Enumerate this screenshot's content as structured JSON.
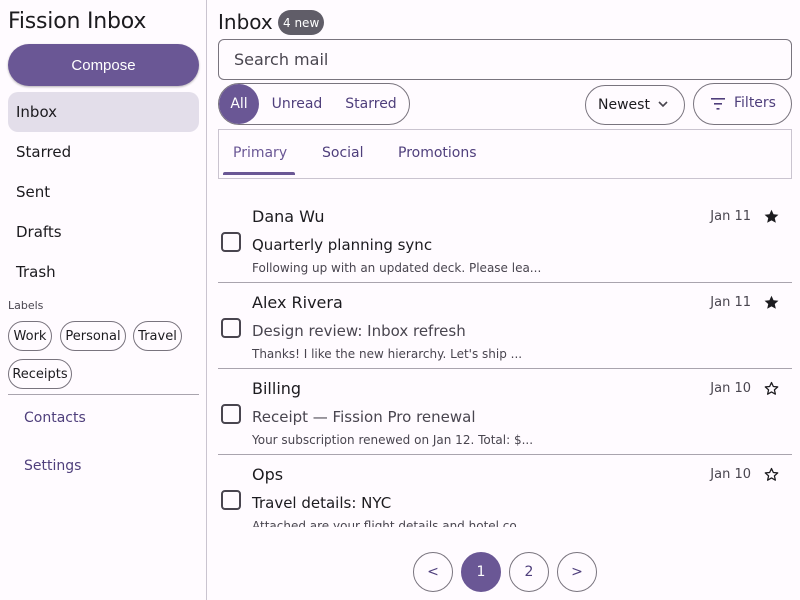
{
  "app_title": "Fission Inbox",
  "compose_label": "Compose",
  "nav": [
    {
      "label": "Inbox",
      "active": true
    },
    {
      "label": "Starred"
    },
    {
      "label": "Sent"
    },
    {
      "label": "Drafts"
    },
    {
      "label": "Trash"
    }
  ],
  "labels_title": "Labels",
  "labels": [
    "Work",
    "Personal",
    "Travel",
    "Receipts"
  ],
  "side_links": [
    "Contacts",
    "Settings"
  ],
  "header": {
    "title": "Inbox",
    "badge": "4 new"
  },
  "search": {
    "placeholder": "Search mail",
    "value": ""
  },
  "segments": [
    {
      "label": "All",
      "active": true
    },
    {
      "label": "Unread"
    },
    {
      "label": "Starred"
    }
  ],
  "sort": {
    "selected": "Newest",
    "icon": "chevron-down-icon"
  },
  "filters_label": "Filters",
  "tabs": [
    {
      "label": "Primary",
      "active": true
    },
    {
      "label": "Social"
    },
    {
      "label": "Promotions"
    }
  ],
  "messages": [
    {
      "sender": "Dana Wu",
      "subject": "Quarterly planning sync",
      "snippet": "Following up with an updated deck. Please lea...",
      "date": "Jan 11",
      "starred": true,
      "unread": true
    },
    {
      "sender": "Alex Rivera",
      "subject": "Design review: Inbox refresh",
      "snippet": "Thanks! I like the new hierarchy. Let's ship ...",
      "date": "Jan 11",
      "starred": true,
      "unread": false
    },
    {
      "sender": "Billing",
      "subject": "Receipt — Fission Pro renewal",
      "snippet": "Your subscription renewed on Jan 12. Total: $...",
      "date": "Jan 10",
      "starred": false,
      "unread": false
    },
    {
      "sender": "Ops",
      "subject": "Travel details: NYC",
      "snippet": "Attached are your flight details and hotel co...",
      "date": "Jan 10",
      "starred": false,
      "unread": true
    }
  ],
  "pagination": {
    "prev": "<",
    "pages": [
      "1",
      "2"
    ],
    "current": "1",
    "next": ">"
  },
  "colors": {
    "primary": "#6a5795",
    "active_nav_bg": "#e3deea",
    "badge_bg": "#605d68",
    "outline": "#79747e"
  }
}
